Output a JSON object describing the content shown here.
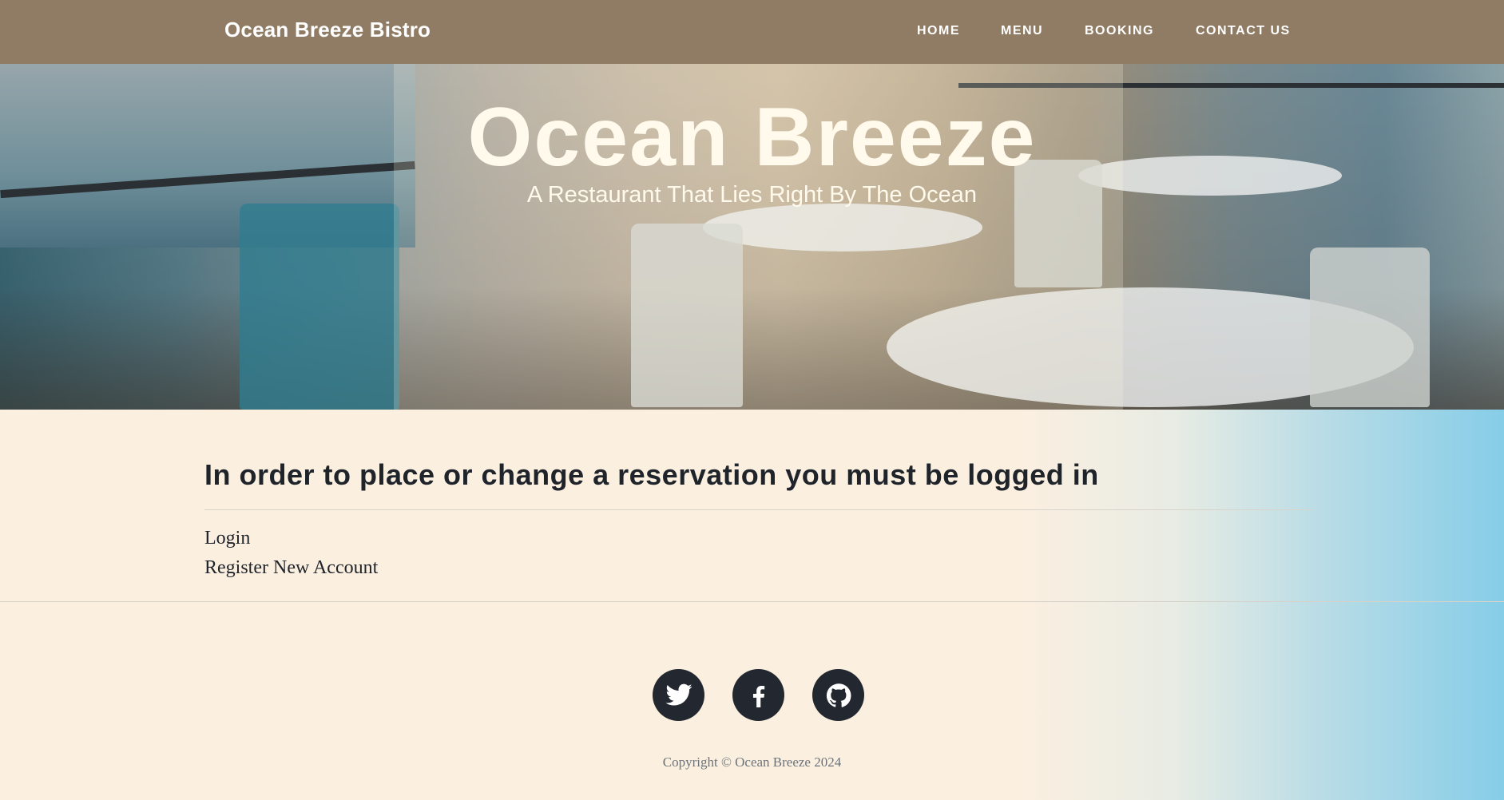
{
  "navbar": {
    "brand": "Ocean Breeze Bistro",
    "links": [
      "HOME",
      "MENU",
      "BOOKING",
      "CONTACT US"
    ]
  },
  "hero": {
    "title": "Ocean Breeze",
    "subtitle": "A Restaurant That Lies Right By The Ocean"
  },
  "main": {
    "heading": "In order to place or change a reservation you must be logged in",
    "links": [
      "Login",
      "Register New Account"
    ]
  },
  "footer": {
    "social_icons": [
      "twitter-icon",
      "facebook-icon",
      "github-icon"
    ],
    "copyright": "Copyright © Ocean Breeze 2024"
  },
  "colors": {
    "navbar_bg": "#907c64",
    "page_bg": "#fbefe0",
    "gradient_right": "#86cde8",
    "heading_text": "#1f232a",
    "social_circle": "#222730"
  }
}
